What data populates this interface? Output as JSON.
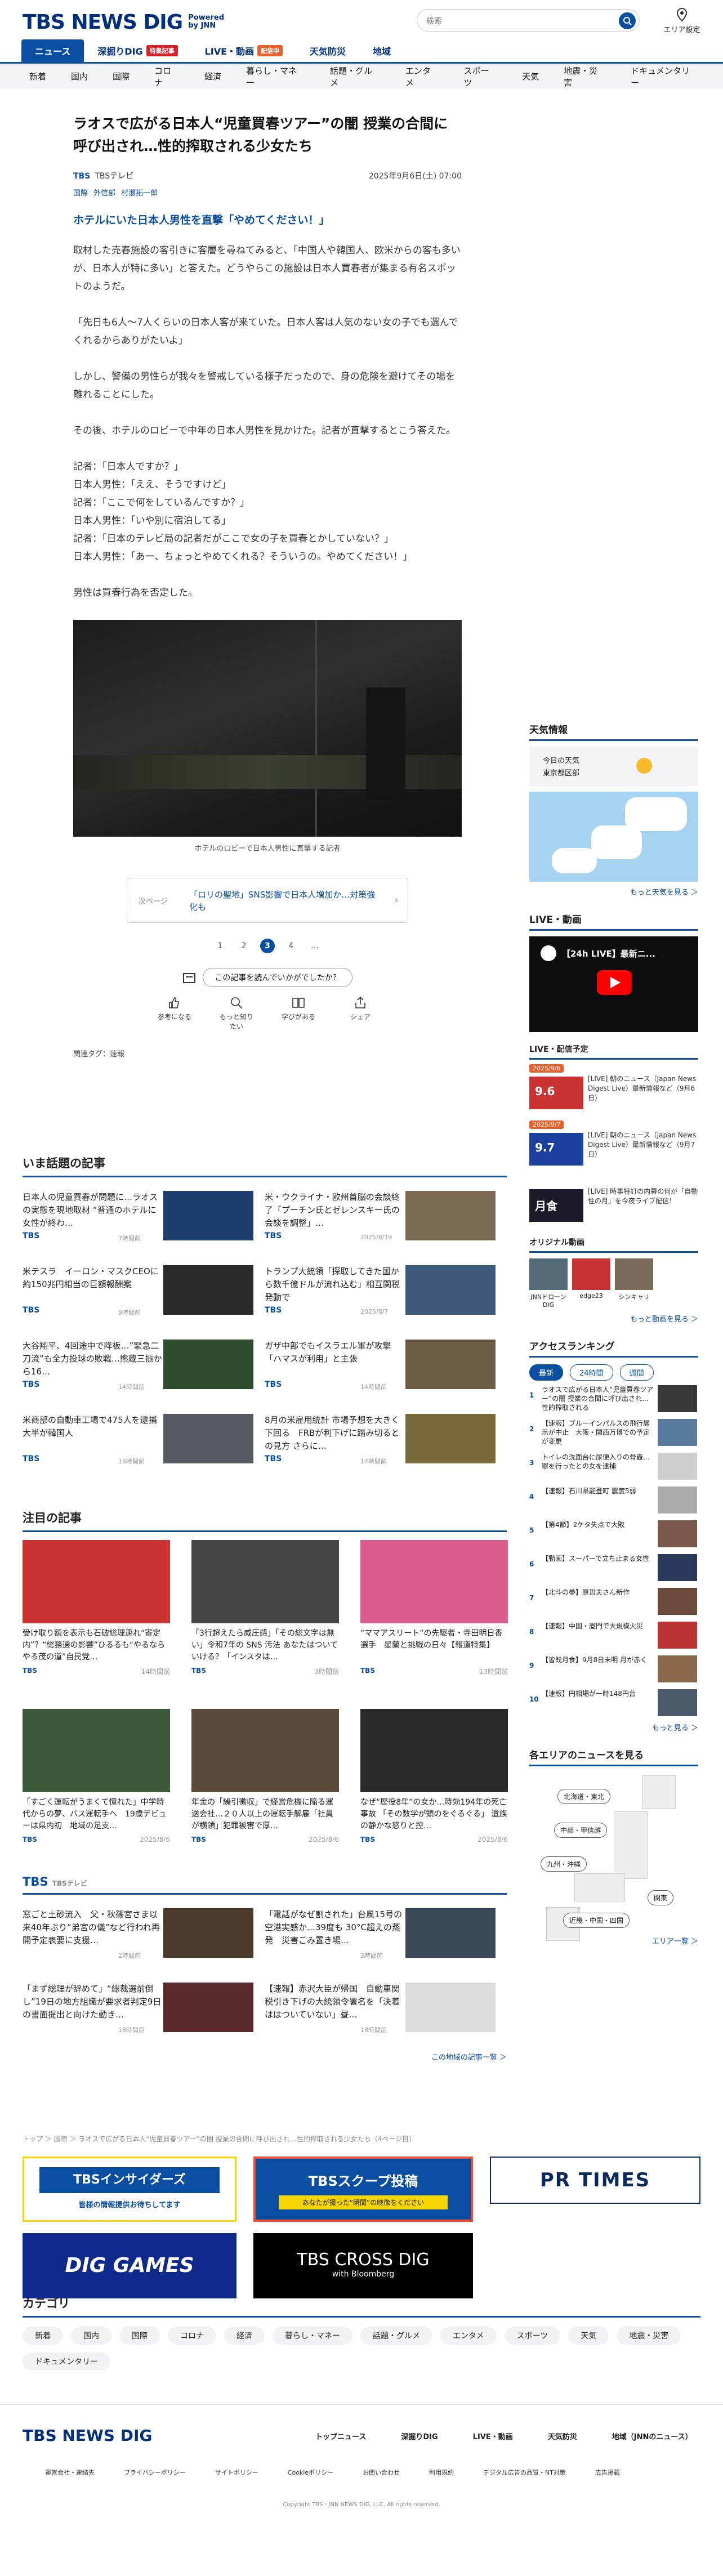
{
  "header": {
    "logo": "TBS NEWS DIG",
    "logo_sub1": "Powered",
    "logo_sub2": "by JNN",
    "search_placeholder": "検索",
    "area_label": "エリア設定",
    "tabs": [
      {
        "label": "ニュース"
      },
      {
        "label": "深掘りDIG",
        "badge": "特集記事"
      },
      {
        "label": "LIVE・動画",
        "badge": "配信中"
      },
      {
        "label": "天気防災"
      },
      {
        "label": "地域"
      }
    ],
    "categories": [
      "新着",
      "国内",
      "国際",
      "コロナ",
      "経済",
      "暮らし・マネー",
      "話題・グルメ",
      "エンタメ",
      "スポーツ",
      "天気",
      "地震・災害",
      "ドキュメンタリー"
    ]
  },
  "article": {
    "title": "ラオスで広がる日本人“児童買春ツアー”の闇 授業の合間に呼び出され…性的搾取される少女たち",
    "source": "TBS",
    "source_name": "TBSテレビ",
    "date": "2025年9月6日(土) 07:00",
    "tags": [
      "国際",
      "外信部",
      "村瀬拓一郎"
    ],
    "lead": "ホテルにいた日本人男性を直撃「やめてください！」",
    "paragraphs": [
      "取材した売春施設の客引きに客層を尋ねてみると、「中国人や韓国人、欧米からの客も多いが、日本人が特に多い」と答えた。どうやらこの施設は日本人買春者が集まる有名スポットのようだ。",
      "「先日も6人〜7人くらいの日本人客が来ていた。日本人客は人気のない女の子でも選んでくれるからありがたいよ」",
      "しかし、警備の男性らが我々を警戒している様子だったので、身の危険を避けてその場を離れることにした。",
      "その後、ホテルのロビーで中年の日本人男性を見かけた。記者が直撃するとこう答えた。",
      "記者：「日本人ですか？」\n日本人男性：「ええ、そうですけど」\n記者：「ここで何をしているんですか？」\n日本人男性：「いや別に宿泊してる」\n記者：「日本のテレビ局の記者だがここで女の子を買春とかしていない？」\n日本人男性：「あー、ちょっとやめてくれる？そういうの。やめてください！」",
      "男性は買春行為を否定した。"
    ],
    "photo_caption": "ホテルのロビーで日本人男性に直撃する記者",
    "next_label": "次ページ",
    "next_title": "「ロリの聖地」SNS影響で日本人増加か…対策強化も",
    "pages": [
      "1",
      "2",
      "3",
      "4",
      "…"
    ],
    "current_page": "3",
    "feedback_question": "この記事を読んでいかがでしたか？",
    "reactions": [
      "参考になる",
      "もっと知りたい",
      "学びがある",
      "シェア"
    ],
    "related_tag": "関連タグ：速報"
  },
  "topics": {
    "heading": "いま話題の記事",
    "items": [
      {
        "title": "日本人の児童買春が問題に…ラオスの実態を現地取材 “普通のホテルに女性が終わ…",
        "source": "TBS",
        "time": "7時間前"
      },
      {
        "title": "米・ウクライナ・欧州首脳の会談終了「プーチン氏とゼレンスキー氏の会談を調整」…",
        "source": "TBS",
        "time": "2025/8/19"
      },
      {
        "title": "米テスラ　イーロン・マスクCEOに約150兆円相当の巨額報酬案",
        "source": "TBS",
        "time": "9時間前"
      },
      {
        "title": "トランプ大統領「探取してきた国から数千億ドルが流れ込む」相互関税発動で",
        "source": "TBS",
        "time": "2025/8/7"
      },
      {
        "title": "大谷翔平、4回途中で降板…”緊急二刀流”も全力投球の敗戦…熊蔵三振から16…",
        "source": "TBS",
        "time": "14時間前"
      },
      {
        "title": "ガザ中部でもイスラエル軍が攻撃「ハマスが利用」と主張",
        "source": "TBS",
        "time": "14時間前"
      },
      {
        "title": "米商部の自動車工場で475人を逮捕　大半が韓国人",
        "source": "TBS",
        "time": "16時間前"
      },
      {
        "title": "8月の米雇用統計 市場予想を大きく下回る　FRBが利下げに踏み切るとの見方 さらに…",
        "source": "TBS",
        "time": "14時間前"
      }
    ]
  },
  "featured": {
    "heading": "注目の記事",
    "items": [
      {
        "title": "受け取り額を表示も石破総理連れ“寄定内”？“総務選の影響”ひるるも“やるならやる茂の道”自民党…",
        "source": "TBS",
        "time": "14時間前"
      },
      {
        "title": "「3行超えたら威圧感」「その総文字は無い」令和7年の SNS 汚法 あなたはついていける？「インスタは…",
        "source": "TBS",
        "time": "3時間前"
      },
      {
        "title": "“ママアスリート”の先駆者・寺田明日香選手　星蘭と挑戦の日々【報道特集】",
        "source": "TBS",
        "time": "13時間前"
      },
      {
        "title": "「すごく運転がうまくて憧れた」中学時代からの夢、バス運転手へ　19歳デビューは県内初　地域の足支…",
        "source": "TBS",
        "time": "2025/8/6"
      },
      {
        "title": "年金の「繰引徴収」で経営危機に陥る運送会社…２０人以上の運転手解雇「社員が横領」犯罪被害で厚…",
        "source": "TBS",
        "time": "2025/8/6"
      },
      {
        "title": "なぜ“歴役8年”の女か…時効194年の死亡事故 「その数学が頭のをぐるぐる」 遺族の静かな怒りと控…",
        "source": "TBS",
        "time": "2025/8/6"
      }
    ]
  },
  "regional": {
    "heading": "TBS",
    "heading_sub": "TBSテレビ",
    "items": [
      {
        "title": "窓ごと土砂流入　父・秋篠宮さま以来40年ぶり“弟宮の儀”など行われ再開予定表要に支援…",
        "time": "2時間前"
      },
      {
        "title": "「電話がなぜ割された」台風15号の空港実感か…39度も 30°C超えの蒸発　災害ごみ置き場…",
        "time": "3時間前"
      },
      {
        "title": "「まず総理が辞めて」“総裁選前倒し”19日の地方組織が要求者判定9日の書面提出と向けた動き…",
        "time": "18時間前"
      },
      {
        "title": "【速報】赤沢大臣が帰国　自動車関税引き下げの大統領令署名を「決着ははついていない」昼…",
        "time": "18時間前"
      }
    ],
    "more": "この地域の記事一覧 ＞"
  },
  "sidebar": {
    "weather_heading": "天気情報",
    "weather_today": "今日の天気",
    "weather_place": "東京都区部",
    "weather_more": "もっと天気を見る ＞",
    "live_heading": "LIVE・動画 ",
    "live_title": "【24h LIVE】最新ニ...",
    "schedule_heading": "LIVE・配信予定",
    "schedule": [
      {
        "badge": "2025/9/6",
        "time": "10:00",
        "title": "[LIVE] 朝のニュース（Japan News Digest Live）最新情報など（9月6日）",
        "date": "9.6"
      },
      {
        "badge": "2025/9/7",
        "time": "10:00",
        "title": "[LIVE] 朝のニュース（Japan News Digest Live）最新情報など（9月7日）",
        "date": "9.7"
      },
      {
        "badge": "",
        "time": "",
        "title": "[LIVE] 時事特訂の内幕の何が「自動性の月」を今夜ライブ配信！",
        "date": "月食"
      }
    ],
    "original_heading": "オリジナル動画",
    "originals": [
      "JNNドローンDIG",
      "edge23",
      "シンキャリ"
    ],
    "original_more": "もっと動画を見る ＞",
    "ranking_heading": "アクセスランキング",
    "ranking_tabs": [
      "最新",
      "24時間",
      "週間"
    ],
    "ranking": [
      "ラオスで広がる日本人“児童買春ツアー”の闇 授業の合間に呼び出され…性的搾取される",
      "【速報】ブルーインパルスの飛行展示が中止　大阪・関西万博での予定が変更",
      "トイレの洗面台に尿便入りの骨壺…罪を行ったとの女を逮捕",
      "【速報】石川県能登町 震度5弱",
      "【第4節】2ケタ失点で大敗",
      "【動画】スーパーで立ち止まる女性",
      "【北斗の拳】原哲夫さん新作",
      "【速報】中国・厦門で大規模火災",
      "【皆既月食】9月8日未明 月が赤く",
      "【速報】円相場が一時148円台"
    ],
    "ranking_more": "もっと見る ＞",
    "area_heading": "各エリアのニュースを見る",
    "areas": [
      "北海道・東北",
      "中部・甲信越",
      "九州・沖縄",
      "関東",
      "近畿・中国・四国"
    ],
    "area_more": "エリア一覧 ＞"
  },
  "breadcrumb": "トップ ＞ 国際 ＞ ラオスで広がる日本人“児童買春ツアー”の闇 授業の合間に呼び出され…性的搾取される少女たち（4ページ目）",
  "banners": {
    "b1": "TBSインサイダーズ",
    "b1_sub": "皆様の情報提供お待ちしてます",
    "b2": "TBSスクープ投稿",
    "b2_sub": "あなたが撮った“瞬間”の映像をください",
    "b3": "PR TIMES",
    "b4": "DIG GAMES",
    "b5": "TBS CROSS DIG",
    "b5_sub": "with Bloomberg"
  },
  "category_section": {
    "heading": "カテゴリ",
    "items": [
      "新着",
      "国内",
      "国際",
      "コロナ",
      "経済",
      "暮らし・マネー",
      "話題・グルメ",
      "エンタメ",
      "スポーツ",
      "天気",
      "地震・災害",
      "ドキュメンタリー"
    ]
  },
  "footer": {
    "logo": "TBS NEWS DIG",
    "nav": [
      "トップニュース",
      "深掘りDIG",
      "LIVE・動画",
      "天気防災",
      "地域（JNNのニュース）"
    ],
    "links": [
      "運営会社・連絡先",
      "プライバシーポリシー",
      "サイトポリシー",
      "Cookieポリシー",
      "お問い合わせ",
      "利用規約",
      "デジタル広告の品質・NT対策",
      "広告掲載"
    ],
    "copyright": "Copyright TBS・JNN NEWS DIG, LLC. All rights reserved."
  },
  "colors": {
    "brand": "#00307a",
    "accent": "#0a4ea2",
    "alert": "#d6222a"
  }
}
